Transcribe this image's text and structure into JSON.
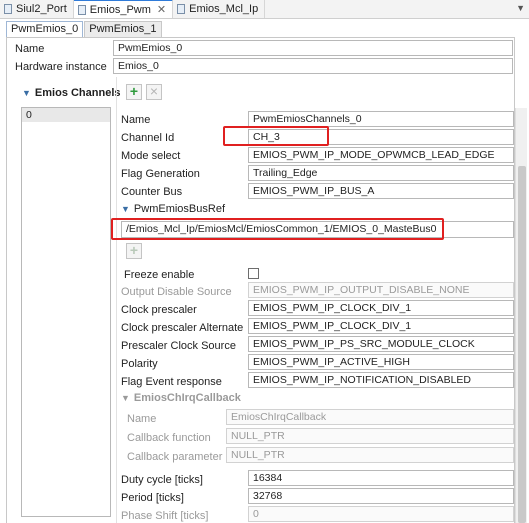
{
  "editor_tabs": [
    {
      "label": "Siul2_Port",
      "active": false
    },
    {
      "label": "Emios_Pwm",
      "active": true
    },
    {
      "label": "Emios_Mcl_Ip",
      "active": false
    }
  ],
  "sub_tabs": [
    "PwmEmios_0",
    "PwmEmios_1"
  ],
  "name": {
    "label": "Name",
    "value": "PwmEmios_0"
  },
  "hardware_instance": {
    "label": "Hardware instance",
    "value": "Emios_0"
  },
  "channels": {
    "title": "Emios Channels",
    "add_label": "+",
    "delete_label": "×",
    "list": [
      "0"
    ]
  },
  "channel": {
    "name": {
      "label": "Name",
      "value": "PwmEmiosChannels_0"
    },
    "channel_id": {
      "label": "Channel Id",
      "value": "CH_3"
    },
    "mode_select": {
      "label": "Mode select",
      "value": "EMIOS_PWM_IP_MODE_OPWMCB_LEAD_EDGE"
    },
    "flag_generation": {
      "label": "Flag Generation",
      "value": "Trailing_Edge"
    },
    "counter_bus": {
      "label": "Counter Bus",
      "value": "EMIOS_PWM_IP_BUS_A"
    },
    "bus_ref": {
      "title": "PwmEmiosBusRef",
      "value": "/Emios_Mcl_Ip/EmiosMcl/EmiosCommon_1/EMIOS_0_MasteBus0",
      "add_label": "+"
    },
    "freeze_enable": {
      "label": "Freeze enable"
    },
    "output_disable_source": {
      "label": "Output Disable Source",
      "value": "EMIOS_PWM_IP_OUTPUT_DISABLE_NONE"
    },
    "clock_prescaler": {
      "label": "Clock prescaler",
      "value": "EMIOS_PWM_IP_CLOCK_DIV_1"
    },
    "clock_prescaler_alt": {
      "label": "Clock prescaler Alternate",
      "value": "EMIOS_PWM_IP_CLOCK_DIV_1"
    },
    "prescaler_clock_source": {
      "label": "Prescaler Clock Source",
      "value": "EMIOS_PWM_IP_PS_SRC_MODULE_CLOCK"
    },
    "polarity": {
      "label": "Polarity",
      "value": "EMIOS_PWM_IP_ACTIVE_HIGH"
    },
    "flag_event_response": {
      "label": "Flag Event response",
      "value": "EMIOS_PWM_IP_NOTIFICATION_DISABLED"
    },
    "callback_section": {
      "title": "EmiosChIrqCallback",
      "name": {
        "label": "Name",
        "value": "EmiosChIrqCallback"
      },
      "callback_function": {
        "label": "Callback function",
        "value": "NULL_PTR"
      },
      "callback_parameter": {
        "label": "Callback parameter",
        "value": "NULL_PTR"
      }
    },
    "duty_cycle": {
      "label": "Duty cycle [ticks]",
      "value": "16384"
    },
    "period": {
      "label": "Period [ticks]",
      "value": "32768"
    },
    "phase_shift": {
      "label": "Phase Shift [ticks]",
      "value": "0"
    }
  },
  "colors": {
    "highlight": "#e02020",
    "accent": "#2f7bd9",
    "add_green": "#2e9a3c"
  }
}
